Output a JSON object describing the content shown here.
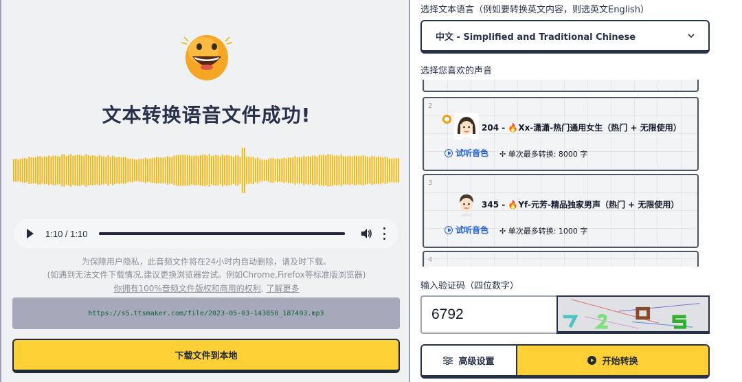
{
  "result": {
    "title": "文本转换语音文件成功!",
    "player": {
      "time": "1:10 / 1:10",
      "progress": 1.0
    },
    "notes": {
      "privacy": "为保障用户隐私，此音频文件将在24小时内自动删除，请及时下载。",
      "browser": "(如遇到无法文件下载情况,建议更换浏览器尝试。例如Chrome,Firefox等标准版浏览器)",
      "copyright": "你拥有100%音频文件版权和商用的权利",
      "learn_more": "了解更多"
    },
    "file_url": "https://s5.ttsmaker.com/file/2023-05-03-143850_187493.mp3",
    "download_label": "下载文件到本地"
  },
  "settings": {
    "language_label": "选择文本语言（例如要转换英文内容，则选英文English）",
    "language_selected": "中文 - Simplified and Traditional Chinese",
    "voice_label": "选择您喜欢的声音",
    "voices": [
      {
        "index": "2",
        "name": "204 - 🔥Xx-潇潇-热门通用女生（热门 + 无限使用）",
        "listen": "试听音色",
        "limit": "单次最多转换: 8000 字",
        "selected": true
      },
      {
        "index": "3",
        "name": "345 - 🔥Yf-元芳-精品独家男声（热门 + 无限使用）",
        "listen": "试听音色",
        "limit": "单次最多转换: 1000 字",
        "selected": false
      },
      {
        "index": "4"
      }
    ],
    "captcha_label": "输入验证码（四位数字）",
    "captcha_value": "6792",
    "advanced_label": "高级设置",
    "start_label": "开始转换"
  },
  "colors": {
    "accent_yellow": "#fdd135",
    "wave_color": "#f5b400",
    "navy": "#27324a"
  }
}
